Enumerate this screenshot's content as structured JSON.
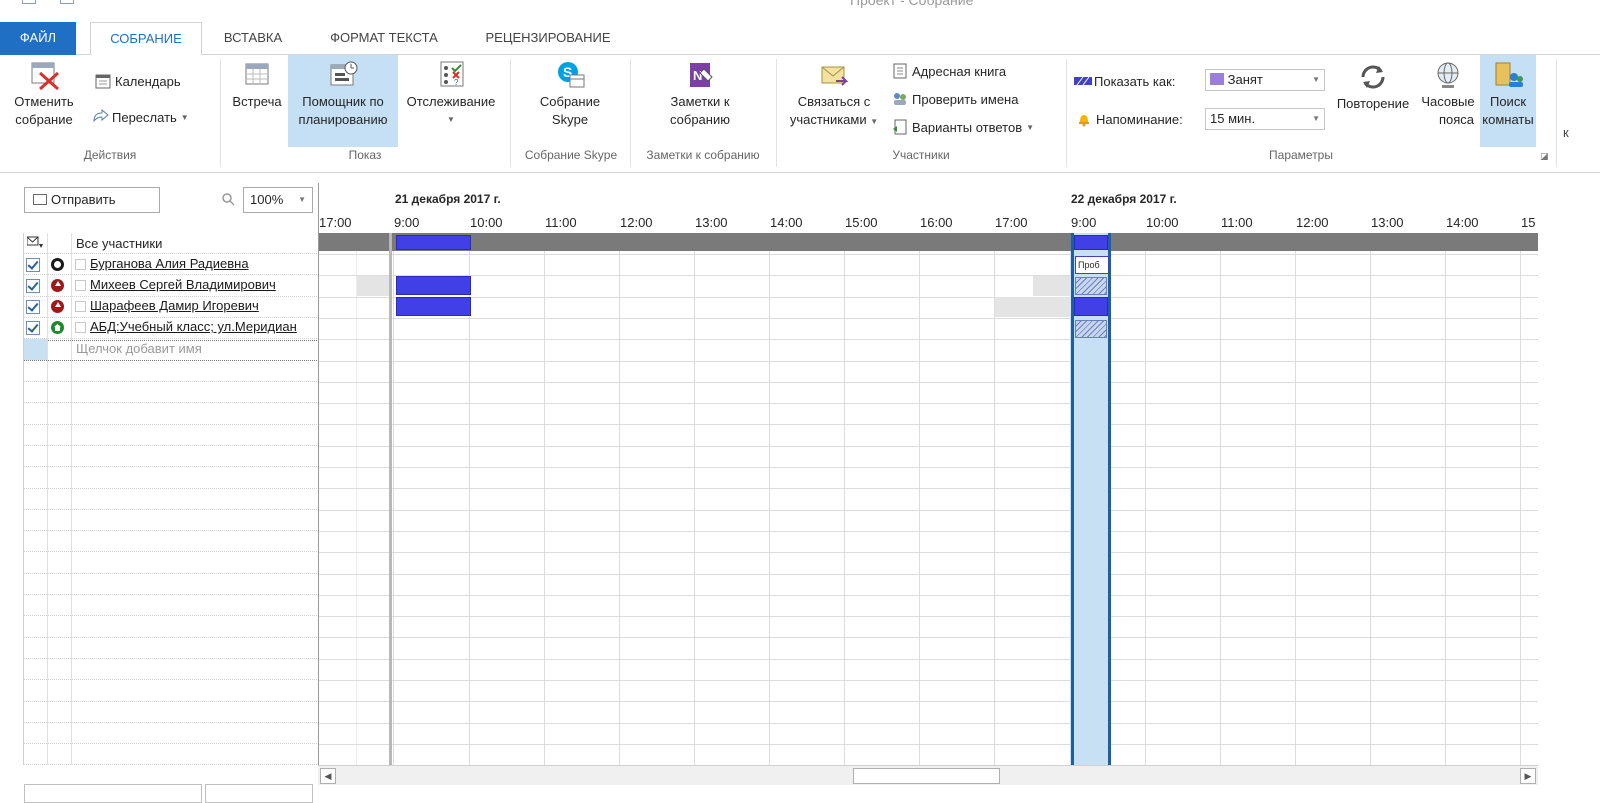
{
  "window": {
    "title": "Проект - Собрание"
  },
  "tabs": [
    {
      "label": "ФАЙЛ"
    },
    {
      "label": "СОБРАНИЕ"
    },
    {
      "label": "ВСТАВКА"
    },
    {
      "label": "ФОРМАТ ТЕКСТА"
    },
    {
      "label": "РЕЦЕНЗИРОВАНИЕ"
    }
  ],
  "ribbon": {
    "actions": {
      "cancel_line1": "Отменить",
      "cancel_line2": "собрание",
      "calendar": "Календарь",
      "forward": "Переслать",
      "label": "Действия"
    },
    "show": {
      "meeting": "Встреча",
      "assistant_line1": "Помощник по",
      "assistant_line2": "планированию",
      "tracking": "Отслеживание",
      "label": "Показ"
    },
    "skype": {
      "line1": "Собрание",
      "line2": "Skype",
      "label": "Собрание Skype"
    },
    "notes": {
      "line1": "Заметки к",
      "line2": "собранию",
      "label": "Заметки к собранию"
    },
    "attendees": {
      "contact_line1": "Связаться с",
      "contact_line2": "участниками",
      "address_book": "Адресная книга",
      "check_names": "Проверить имена",
      "response_options": "Варианты ответов",
      "label": "Участники"
    },
    "options": {
      "show_as_label": "Показать как:",
      "show_as_value": "Занят",
      "reminder_label": "Напоминание:",
      "reminder_value": "15 мин.",
      "recurrence": "Повторение",
      "timezones_line1": "Часовые",
      "timezones_line2": "пояса",
      "rooms_line1": "Поиск",
      "rooms_line2": "комнаты",
      "label": "Параметры",
      "overflow": "к"
    }
  },
  "toolbar": {
    "send": "Отправить",
    "zoom": "100%"
  },
  "attendees_list": {
    "header": "Все участники",
    "people": [
      {
        "name": "Бурганова Алия Радиевна"
      },
      {
        "name": "Михеев Сергей Владимирович"
      },
      {
        "name": "Шарафеев Дамир Игоревич"
      },
      {
        "name": "АБД:Учебный класс; ул.Меридиан"
      }
    ],
    "add_placeholder": "Щелчок добавит имя"
  },
  "timeline": {
    "date1": "21 декабря 2017 г.",
    "date2": "22 декабря 2017 г.",
    "times": [
      "17:00",
      "9:00",
      "10:00",
      "11:00",
      "12:00",
      "13:00",
      "14:00",
      "15:00",
      "16:00",
      "17:00",
      "9:00",
      "10:00",
      "11:00",
      "12:00",
      "13:00",
      "14:00",
      "15"
    ],
    "tentative_label": "Проб"
  },
  "colors": {
    "accent": "#1f6fc5",
    "busy": "#4040e6",
    "meeting_selection": "#c7e0f4"
  }
}
